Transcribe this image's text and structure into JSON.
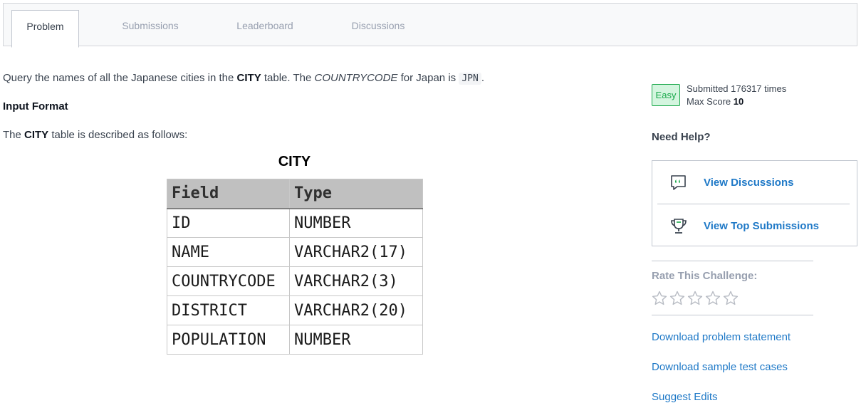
{
  "tabs": [
    {
      "label": "Problem"
    },
    {
      "label": "Submissions"
    },
    {
      "label": "Leaderboard"
    },
    {
      "label": "Discussions"
    }
  ],
  "problem": {
    "line1": {
      "t1": "Query the names of all the Japanese cities in the ",
      "b1": "CITY",
      "t2": " table. The ",
      "i1": "COUNTRYCODE",
      "t3": " for Japan is ",
      "code": "JPN",
      "t4": "."
    },
    "input_format": "Input Format",
    "line2": {
      "t1": "The ",
      "b1": "CITY",
      "t2": " table is described as follows:"
    }
  },
  "city_table": {
    "title": "CITY",
    "headers": [
      "Field",
      "Type"
    ],
    "rows": [
      [
        "ID",
        "NUMBER"
      ],
      [
        "NAME",
        "VARCHAR2(17)"
      ],
      [
        "COUNTRYCODE",
        "VARCHAR2(3)"
      ],
      [
        "DISTRICT",
        "VARCHAR2(20)"
      ],
      [
        "POPULATION",
        "NUMBER"
      ]
    ]
  },
  "sidebar": {
    "difficulty": "Easy",
    "submitted_text": "Submitted 176317 times",
    "max_score_label": "Max Score ",
    "max_score_value": "10",
    "need_help": "Need Help?",
    "help_links": [
      {
        "label": "View Discussions",
        "icon": "discussion-icon"
      },
      {
        "label": "View Top Submissions",
        "icon": "trophy-icon"
      }
    ],
    "rate_label": "Rate This Challenge:",
    "rating_value": 0,
    "rating_max": 5,
    "links": [
      "Download problem statement",
      "Download sample test cases",
      "Suggest Edits"
    ]
  },
  "colors": {
    "accent_link": "#1f79c7",
    "easy_green": "#1ba94c",
    "easy_bg": "#d4f5df"
  }
}
